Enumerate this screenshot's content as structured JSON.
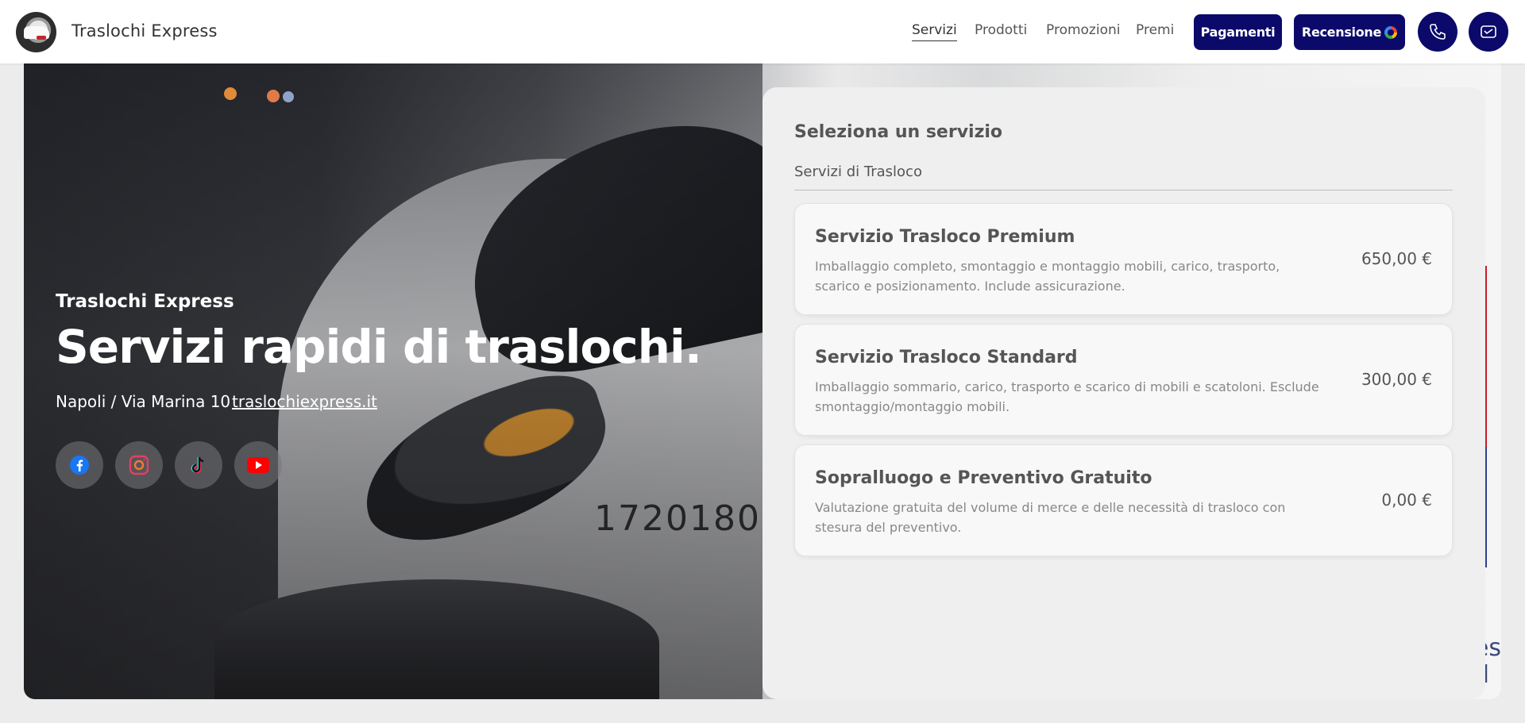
{
  "header": {
    "brand": "Traslochi Express",
    "nav": [
      "Servizi",
      "Prodotti",
      "Promozioni",
      "Premi"
    ],
    "pay_button": "Pagamenti",
    "review_button": "Recensione"
  },
  "hero": {
    "subtitle": "Traslochi Express",
    "title": "Servizi rapidi di traslochi.",
    "address": "Napoli / Via Marina 10",
    "website": "traslochiexpress.it",
    "plate": "1720180",
    "side_text": "es\nd",
    "social": [
      "facebook-icon",
      "instagram-icon",
      "tiktok-icon",
      "youtube-icon"
    ]
  },
  "panel": {
    "title": "Seleziona un servizio",
    "category": "Servizi di Trasloco",
    "services": [
      {
        "name": "Servizio Trasloco Premium",
        "description": "Imballaggio completo, smontaggio e montaggio mobili, carico, trasporto, scarico e posizionamento. Include assicurazione.",
        "price": "650,00 €"
      },
      {
        "name": "Servizio Trasloco Standard",
        "description": "Imballaggio sommario, carico, trasporto e scarico di mobili e scatoloni. Esclude smontaggio/montaggio mobili.",
        "price": "300,00 €"
      },
      {
        "name": "Sopralluogo e Preventivo Gratuito",
        "description": "Valutazione gratuita del volume di merce e delle necessità di trasloco con stesura del preventivo.",
        "price": "0,00 €"
      }
    ]
  },
  "colors": {
    "accent": "#0b0a6b",
    "panel_bg": "#efefef",
    "card_bg": "#f8f8f8"
  }
}
